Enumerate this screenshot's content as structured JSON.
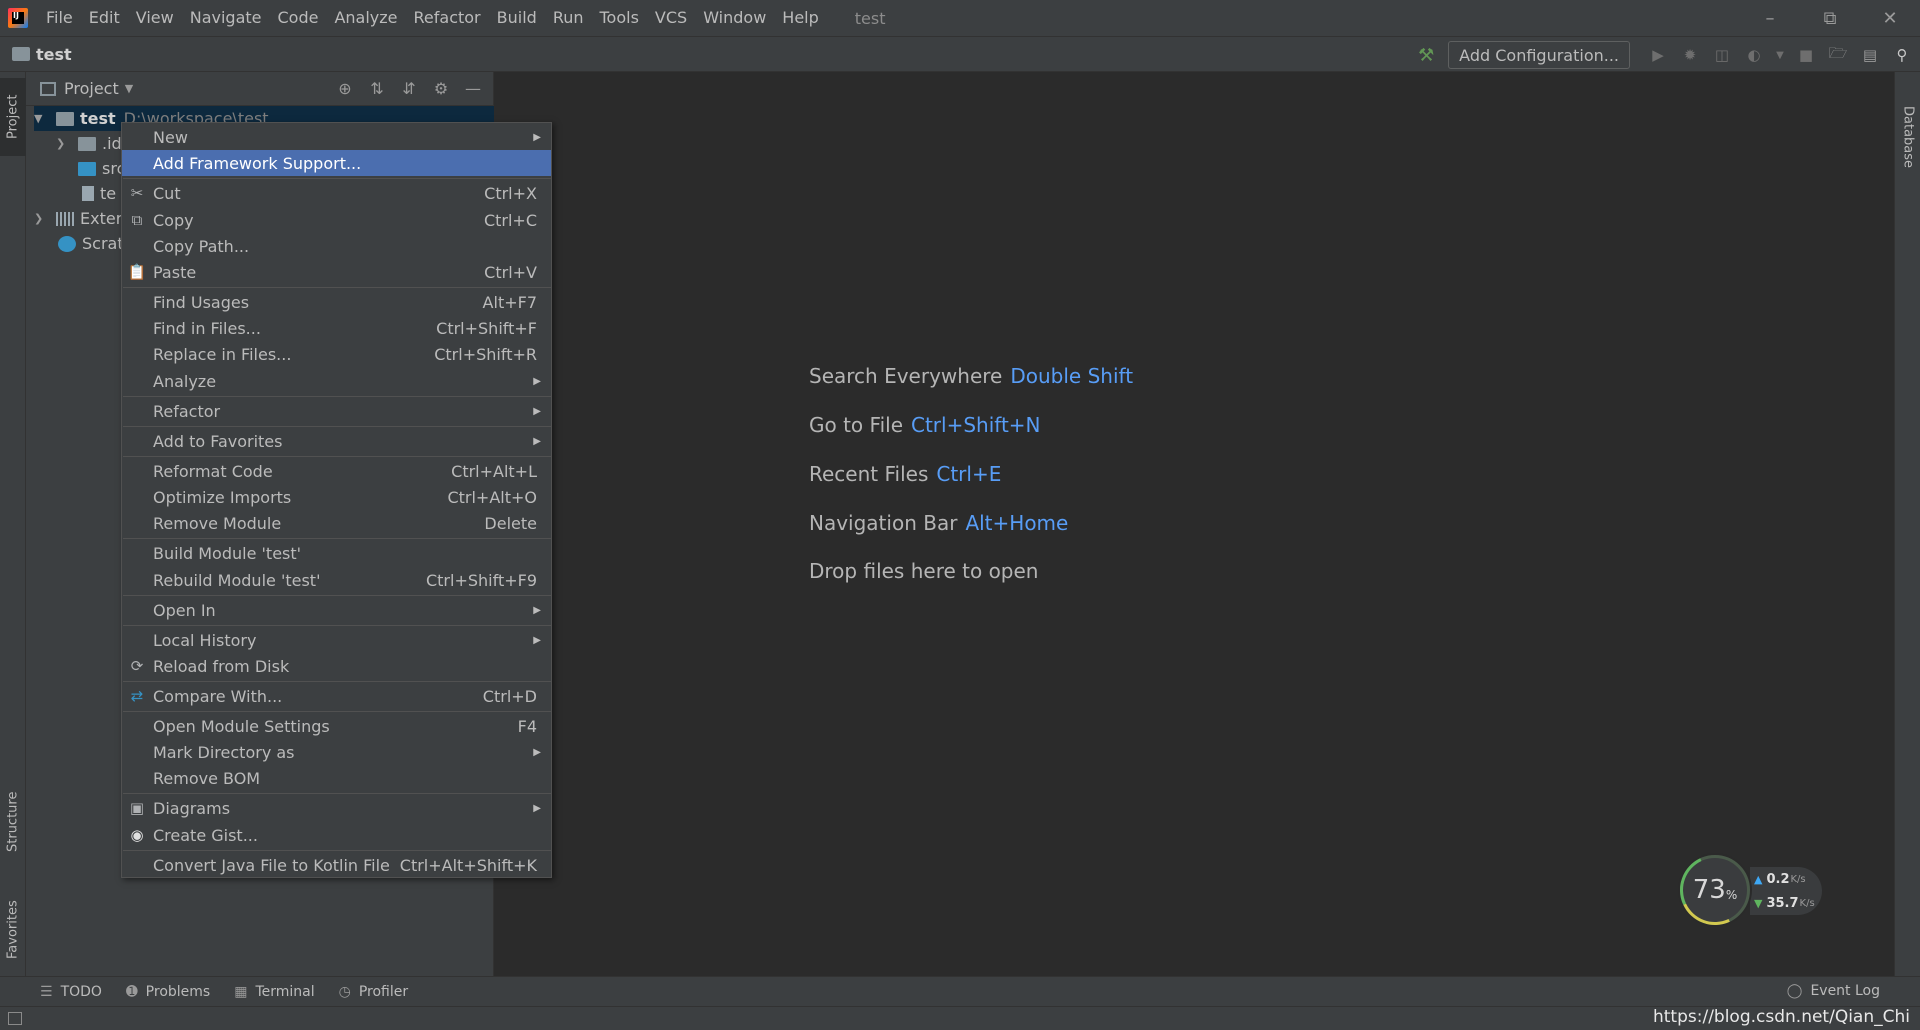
{
  "menubar": {
    "items": [
      "File",
      "Edit",
      "View",
      "Navigate",
      "Code",
      "Analyze",
      "Refactor",
      "Build",
      "Run",
      "Tools",
      "VCS",
      "Window",
      "Help"
    ],
    "window_title": "test",
    "logo_text": "IJ"
  },
  "navbar": {
    "project_name": "test",
    "add_config_label": "Add Configuration..."
  },
  "left_strip": {
    "project_tab": "Project",
    "structure_tab": "Structure",
    "favorites_tab": "Favorites"
  },
  "right_strip": {
    "database_tab": "Database"
  },
  "project_panel": {
    "header_label": "Project",
    "tree": [
      {
        "name": "test",
        "path": "D:\\workspace\\test"
      },
      {
        "name": ".id"
      },
      {
        "name": "src"
      },
      {
        "name": "te"
      },
      {
        "name": "Extern"
      },
      {
        "name": "Scratc"
      }
    ]
  },
  "context_menu": {
    "new": "New",
    "add_framework": "Add Framework Support...",
    "cut": "Cut",
    "cut_sc": "Ctrl+X",
    "copy": "Copy",
    "copy_sc": "Ctrl+C",
    "copy_path": "Copy Path...",
    "paste": "Paste",
    "paste_sc": "Ctrl+V",
    "find_usages": "Find Usages",
    "find_usages_sc": "Alt+F7",
    "find_in_files": "Find in Files...",
    "find_in_files_sc": "Ctrl+Shift+F",
    "replace_in_files": "Replace in Files...",
    "replace_in_files_sc": "Ctrl+Shift+R",
    "analyze": "Analyze",
    "refactor": "Refactor",
    "add_to_favorites": "Add to Favorites",
    "reformat_code": "Reformat Code",
    "reformat_code_sc": "Ctrl+Alt+L",
    "optimize_imports": "Optimize Imports",
    "optimize_imports_sc": "Ctrl+Alt+O",
    "remove_module": "Remove Module",
    "remove_module_sc": "Delete",
    "build_module": "Build Module 'test'",
    "rebuild_module": "Rebuild Module 'test'",
    "rebuild_module_sc": "Ctrl+Shift+F9",
    "open_in": "Open In",
    "local_history": "Local History",
    "reload_from_disk": "Reload from Disk",
    "compare_with": "Compare With...",
    "compare_with_sc": "Ctrl+D",
    "open_module_settings": "Open Module Settings",
    "open_module_settings_sc": "F4",
    "mark_directory_as": "Mark Directory as",
    "remove_bom": "Remove BOM",
    "diagrams": "Diagrams",
    "create_gist": "Create Gist...",
    "convert_java": "Convert Java File to Kotlin File",
    "convert_java_sc": "Ctrl+Alt+Shift+K"
  },
  "editor": {
    "hints": [
      {
        "label": "Search Everywhere",
        "key": "Double Shift"
      },
      {
        "label": "Go to File",
        "key": "Ctrl+Shift+N"
      },
      {
        "label": "Recent Files",
        "key": "Ctrl+E"
      },
      {
        "label": "Navigation Bar",
        "key": "Alt+Home"
      }
    ],
    "drop_text": "Drop files here to open"
  },
  "net_widget": {
    "percent": "73",
    "percent_sign": "%",
    "upload": "0.2",
    "download": "35.7",
    "unit": "K/s"
  },
  "bottom_bar": {
    "todo": "TODO",
    "problems": "Problems",
    "terminal": "Terminal",
    "profiler": "Profiler",
    "event_log": "Event Log"
  },
  "status_bar": {
    "watermark": "https://blog.csdn.net/Qian_Chi"
  },
  "colors": {
    "accent": "#4b6eaf",
    "hint_key": "#589df6",
    "background": "#2b2b2b",
    "panel": "#3c3f41"
  }
}
